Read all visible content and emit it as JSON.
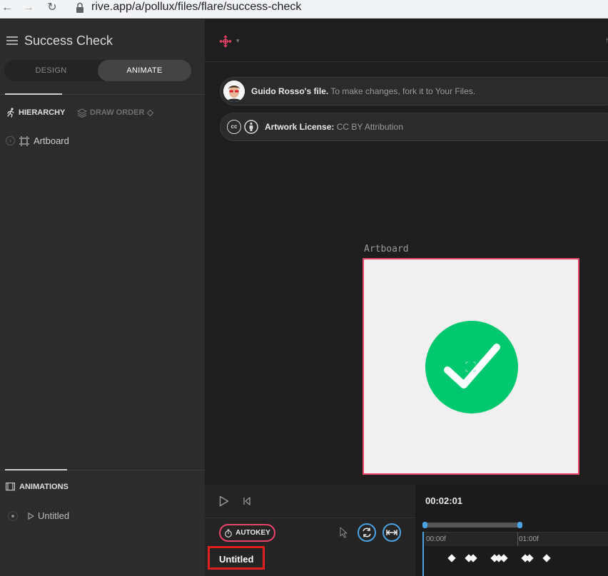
{
  "browser": {
    "url": "rive.app/a/pollux/files/flare/success-check"
  },
  "sidebar": {
    "file_title": "Success Check",
    "modes": {
      "design": "DESIGN",
      "animate": "ANIMATE"
    },
    "tabs": {
      "hierarchy": "HIERARCHY",
      "draw_order": "DRAW ORDER"
    },
    "tree": [
      {
        "label": "Artboard"
      }
    ],
    "animations": {
      "header": "ANIMATIONS",
      "items": [
        {
          "label": "Untitled"
        }
      ]
    }
  },
  "notices": {
    "owner_name": "Guido Rosso's file.",
    "owner_message": "To make changes, fork it to Your Files.",
    "license_label": "Artwork License:",
    "license_value": "CC BY Attribution"
  },
  "canvas": {
    "artboard_label": "Artboard",
    "accent_color": "#e8436a",
    "check_color": "#00c86e"
  },
  "timeline": {
    "autokey_label": "AUTOKEY",
    "animation_name": "Untitled",
    "current_time": "00:02:01",
    "ticks": [
      "00:00f",
      "01:00f"
    ],
    "accent_blue": "#4ba3e3"
  }
}
